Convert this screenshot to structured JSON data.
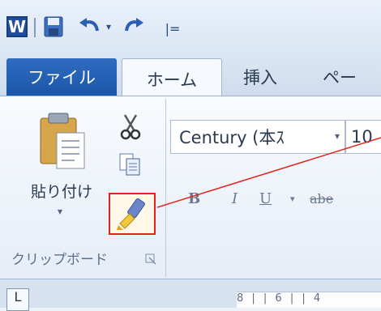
{
  "app_icon_letter": "W",
  "quick_access": {
    "save": "save-icon",
    "undo": "undo-icon",
    "redo": "redo-icon",
    "customize_glyph": "|="
  },
  "tabs": [
    {
      "label": "ファイル",
      "active": false
    },
    {
      "label": "ホーム",
      "active": true
    },
    {
      "label": "挿入",
      "active": false
    },
    {
      "label": "ペー",
      "active": false
    }
  ],
  "clipboard": {
    "paste_label": "貼り付け",
    "group_label": "クリップボード"
  },
  "font": {
    "name": "Century (本ｽ",
    "size": "10"
  },
  "format_buttons": {
    "bold": "B",
    "italic": "I",
    "underline": "U",
    "strikethrough": "abe"
  },
  "ruler_text": "8 |  | 6 |  | 4",
  "colors": {
    "file_tab": "#1b56a8",
    "highlight": "#e0241e"
  }
}
